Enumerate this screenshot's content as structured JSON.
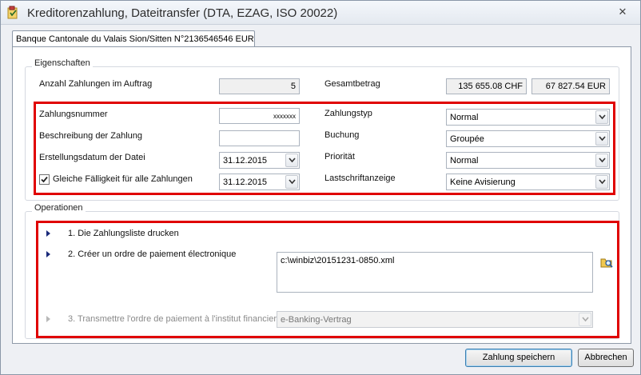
{
  "window": {
    "title": "Kreditorenzahlung, Dateitransfer (DTA, EZAG, ISO 20022)",
    "close_glyph": "✕"
  },
  "tab": {
    "label": "Banque Cantonale du Valais Sion/Sitten N°2136546546 EUR"
  },
  "properties": {
    "legend": "Eigenschaften",
    "payments_count_label": "Anzahl Zahlungen im Auftrag",
    "payments_count_value": "5",
    "total_label": "Gesamtbetrag",
    "total_chf": "135 655.08 CHF",
    "total_eur": "67 827.54 EUR",
    "payment_number_label": "Zahlungsnummer",
    "payment_number_value": "xxxxxxx",
    "description_label": "Beschreibung der Zahlung",
    "description_value": "",
    "file_date_label": "Erstellungsdatum der Datei",
    "file_date_value": "31.12.2015",
    "same_due_label": "Gleiche Fälligkeit für alle Zahlungen",
    "same_due_checked": true,
    "same_due_value": "31.12.2015",
    "payment_type_label": "Zahlungstyp",
    "payment_type_value": "Normal",
    "booking_label": "Buchung",
    "booking_value": "Groupée",
    "priority_label": "Priorität",
    "priority_value": "Normal",
    "debit_notice_label": "Lastschriftanzeige",
    "debit_notice_value": "Keine Avisierung"
  },
  "operations": {
    "legend": "Operationen",
    "op1_label": "1. Die Zahlungsliste drucken",
    "op2_label": "2. Créer un ordre de paiement électronique",
    "op2_path": "c:\\winbiz\\20151231-0850.xml",
    "op3_label": "3. Transmettre l'ordre de paiement à l'institut financier",
    "op3_value": "e-Banking-Vertrag"
  },
  "footer": {
    "save_label": "Zahlung speichern",
    "cancel_label": "Abbrechen"
  },
  "colors": {
    "highlight": "#e00000",
    "arrow": "#1a2a7a"
  }
}
